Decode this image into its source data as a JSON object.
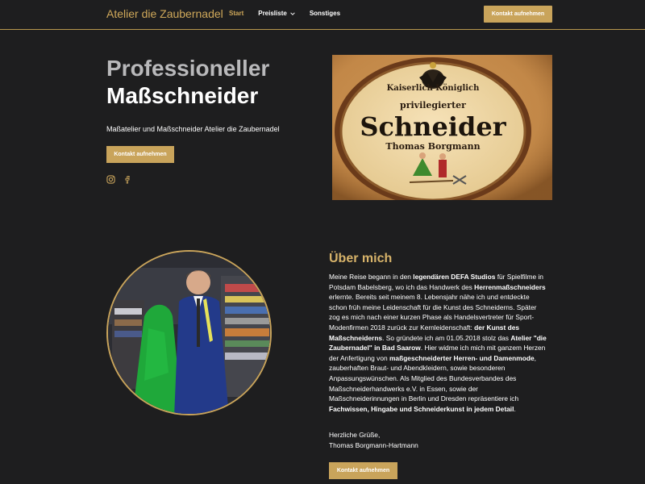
{
  "header": {
    "brand": "Atelier die Zaubernadel",
    "nav": [
      {
        "label": "Start",
        "active": true
      },
      {
        "label": "Preisliste",
        "has_dropdown": true
      },
      {
        "label": "Sonstiges"
      }
    ],
    "cta_label": "Kontakt aufnehmen"
  },
  "hero": {
    "title_line1": "Professioneller",
    "title_line2": "Maßschneider",
    "subtitle": "Maßatelier und Maßschneider Atelier die Zaubernadel",
    "cta_label": "Kontakt aufnehmen",
    "socials": [
      "instagram-icon",
      "facebook-icon"
    ],
    "sign": {
      "line1": "Kaiserlich Königlich",
      "line2": "privilegierter",
      "line3": "Schneider",
      "line4": "Thomas Borgmann"
    }
  },
  "about": {
    "title": "Über mich",
    "paragraph": [
      {
        "t": "Meine Reise begann in den "
      },
      {
        "t": "legendären DEFA Studios",
        "b": true
      },
      {
        "t": " für Spielfilme in Potsdam Babelsberg, wo ich das Handwerk des "
      },
      {
        "t": "Herrenmaßschneiders",
        "b": true
      },
      {
        "t": " erlernte.  Bereits seit meinem 8. Lebensjahr nähe ich  und entdeckte schon früh meine Leidenschaft für die  Kunst des Schneiderns. Später zog es mich nach einer kurzen Phase als Handelsvertreter für Sport-Modenfirmen 2018 zurück zur Kernleidenschaft: "
      },
      {
        "t": "der Kunst des Maßschneiderns",
        "b": true
      },
      {
        "t": ". So gründete ich am 01.05.2018 stolz das "
      },
      {
        "t": "Atelier \"die Zaubernadel\" in Bad Saarow",
        "b": true
      },
      {
        "t": ". Hier widme ich mich mit ganzem Herzen der Anfertigung von "
      },
      {
        "t": "maßgeschneiderter Herren- und Damenmode",
        "b": true
      },
      {
        "t": ", zauberhaften Braut- und Abendkleidern, sowie besonderen Anpassungswünschen. Als Mitglied des Bundesverbandes des Maßschneiderhandwerks e.V. in Essen, sowie der Maßschneiderinnungen in Berlin und Dresden repräsentiere ich "
      },
      {
        "t": "Fachwissen, Hingabe und Schneiderkunst in jedem Detail",
        "b": true
      },
      {
        "t": "."
      }
    ],
    "greeting_line1": "Herzliche Grüße,",
    "greeting_line2": "Thomas Borgmann-Hartmann",
    "cta_label": "Kontakt aufnehmen"
  },
  "colors": {
    "background": "#1e1e1f",
    "accent": "#c9a45b",
    "heading_gold": "#d7b36a",
    "title_grey": "#b9b9bb"
  }
}
